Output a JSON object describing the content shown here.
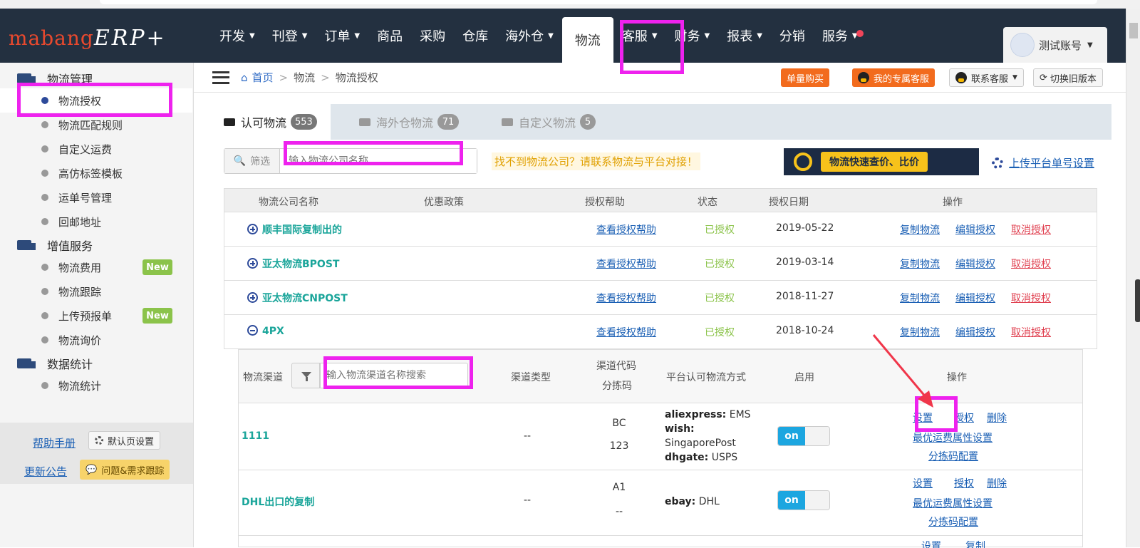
{
  "header": {
    "logo_main": "mabang",
    "logo_sub": "ERP+",
    "nav": [
      {
        "label": "开发",
        "dropdown": true
      },
      {
        "label": "刊登",
        "dropdown": true
      },
      {
        "label": "订单",
        "dropdown": true
      },
      {
        "label": "商品",
        "dropdown": false
      },
      {
        "label": "采购",
        "dropdown": false
      },
      {
        "label": "仓库",
        "dropdown": false
      },
      {
        "label": "海外仓",
        "dropdown": true
      },
      {
        "label": "物流",
        "dropdown": false,
        "active": true
      },
      {
        "label": "客服",
        "dropdown": true
      },
      {
        "label": "财务",
        "dropdown": true
      },
      {
        "label": "报表",
        "dropdown": true
      },
      {
        "label": "分销",
        "dropdown": false
      },
      {
        "label": "服务",
        "dropdown": true,
        "dot": true
      }
    ],
    "account": "测试账号"
  },
  "sidebar": {
    "groups": [
      {
        "title": "物流管理",
        "items": [
          "物流授权",
          "物流匹配规则",
          "自定义运费",
          "高仿标签模板",
          "运单号管理",
          "回邮地址"
        ]
      },
      {
        "title": "增值服务",
        "items": [
          "物流费用",
          "物流跟踪",
          "上传预报单",
          "物流询价"
        ]
      },
      {
        "title": "数据统计",
        "items": [
          "物流统计"
        ]
      }
    ],
    "new_badge": "New",
    "help_link": "帮助手册",
    "default_page_btn": "默认页设置",
    "news_link": "更新公告",
    "issue_btn": "问题&需求跟踪"
  },
  "breadcrumb": {
    "home": "首页",
    "level1": "物流",
    "level2": "物流授权"
  },
  "top_actions": {
    "buy": "单量购买",
    "my_service": "我的专属客服",
    "contact": "联系客服",
    "old_version": "切换旧版本"
  },
  "tabs": [
    {
      "label": "认可物流",
      "count": "553"
    },
    {
      "label": "海外仓物流",
      "count": "71"
    },
    {
      "label": "自定义物流",
      "count": "5"
    }
  ],
  "filter": {
    "label": "筛选",
    "placeholder": "输入物流公司名称"
  },
  "warning": "找不到物流公司？请联系物流与平台对接！",
  "quote_banner": "物流快速查价、比价",
  "upload_link": "上传平台单号设置",
  "table": {
    "headers": [
      "物流公司名称",
      "优惠政策",
      "授权帮助",
      "状态",
      "授权日期",
      "操作"
    ],
    "rows": [
      {
        "name": "顺丰国际复制出的",
        "help": "查看授权帮助",
        "status": "已授权",
        "date": "2019-05-22",
        "expanded": false
      },
      {
        "name": "亚太物流BPOST",
        "help": "查看授权帮助",
        "status": "已授权",
        "date": "2019-03-14",
        "expanded": false
      },
      {
        "name": "亚太物流CNPOST",
        "help": "查看授权帮助",
        "status": "已授权",
        "date": "2018-11-27",
        "expanded": false
      },
      {
        "name": "4PX",
        "help": "查看授权帮助",
        "status": "已授权",
        "date": "2018-10-24",
        "expanded": true
      }
    ],
    "row_actions": {
      "copy": "复制物流",
      "edit": "编辑授权",
      "cancel": "取消授权"
    }
  },
  "subtable": {
    "headers": {
      "channel": "物流渠道",
      "type": "渠道类型",
      "code": "渠道代码",
      "sort_code": "分拣码",
      "platform": "平台认可物流方式",
      "enable": "启用",
      "ops": "操作"
    },
    "channel_placeholder": "输入物流渠道名称搜索",
    "rows": [
      {
        "name": "1111",
        "type": "--",
        "code": "BC",
        "sort_code": "123",
        "platforms": [
          {
            "p": "aliexpress:",
            "v": "EMS"
          },
          {
            "p": "wish:",
            "v": ""
          },
          {
            "p": "",
            "v": "SingaporePost"
          },
          {
            "p": "dhgate:",
            "v": "USPS"
          }
        ],
        "enabled": "on"
      },
      {
        "name": "DHL出口的复制",
        "type": "--",
        "code": "A1",
        "sort_code": "--",
        "platforms": [
          {
            "p": "ebay:",
            "v": "DHL"
          }
        ],
        "enabled": "on"
      }
    ],
    "ops": {
      "settings": "设置",
      "auth": "授权",
      "delete": "删除",
      "best_fee": "最优运费属性设置",
      "sort_config": "分拣码配置",
      "copy": "复制"
    }
  }
}
